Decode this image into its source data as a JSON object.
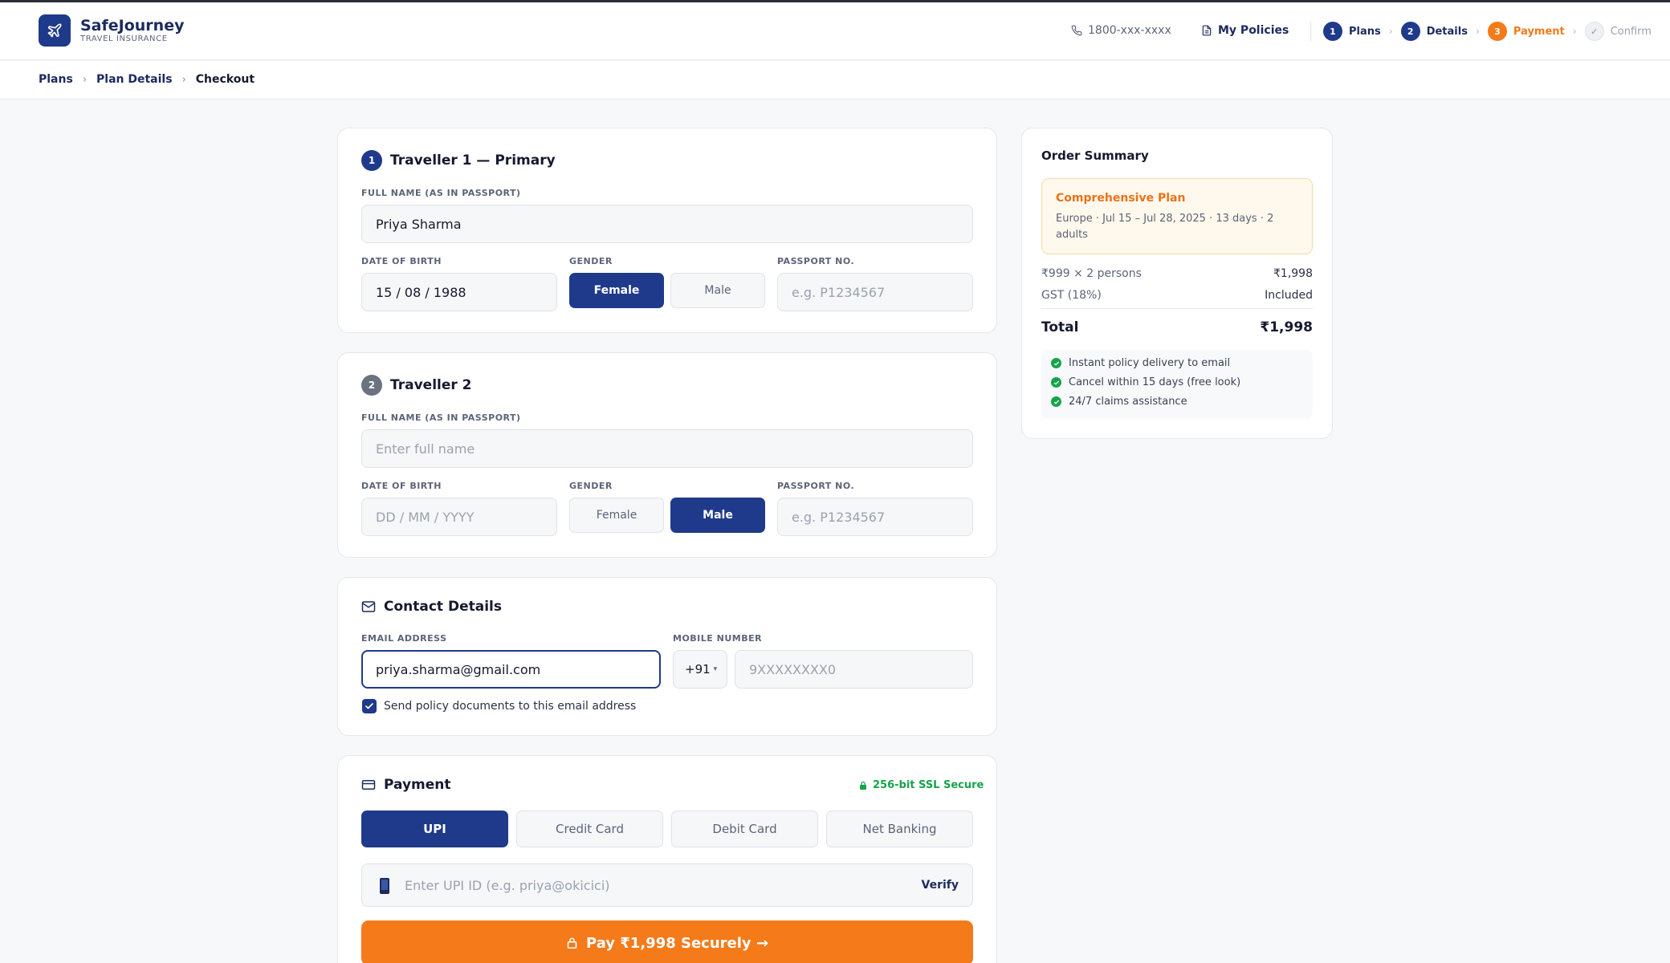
{
  "header": {
    "brand": "SafeJourney",
    "brand_sub": "TRAVEL INSURANCE",
    "phone": "1800-xxx-xxxx",
    "my_policies": "My Policies",
    "steps": [
      {
        "num": "1",
        "label": "Plans",
        "state": "done"
      },
      {
        "num": "2",
        "label": "Details",
        "state": "done"
      },
      {
        "num": "3",
        "label": "Payment",
        "state": "current"
      },
      {
        "num": "✓",
        "label": "Confirm",
        "state": "upcoming"
      }
    ]
  },
  "breadcrumb": {
    "items": [
      "Plans",
      "Plan Details"
    ],
    "current": "Checkout"
  },
  "traveller1": {
    "num": "1",
    "title": "Traveller 1 — Primary",
    "name_label": "FULL NAME (AS IN PASSPORT)",
    "name_value": "Priya Sharma",
    "dob_label": "DATE OF BIRTH",
    "dob_value": "15 / 08 / 1988",
    "gender_label": "GENDER",
    "gender_female": "Female",
    "gender_male": "Male",
    "passport_label": "PASSPORT NO.",
    "passport_placeholder": "e.g. P1234567"
  },
  "traveller2": {
    "num": "2",
    "title": "Traveller 2",
    "name_label": "FULL NAME (AS IN PASSPORT)",
    "name_placeholder": "Enter full name",
    "dob_label": "DATE OF BIRTH",
    "dob_placeholder": "DD / MM / YYYY",
    "gender_label": "GENDER",
    "gender_female": "Female",
    "gender_male": "Male",
    "passport_label": "PASSPORT NO.",
    "passport_placeholder": "e.g. P1234567"
  },
  "contact": {
    "title": "Contact Details",
    "email_label": "EMAIL ADDRESS",
    "email_value": "priya.sharma@gmail.com",
    "mobile_label": "MOBILE NUMBER",
    "country_code": "+91",
    "mobile_placeholder": "9XXXXXXXX0",
    "checkbox_label": "Send policy documents to this email address"
  },
  "payment": {
    "title": "Payment",
    "ssl_badge": "256-bit SSL Secure",
    "methods": [
      "UPI",
      "Credit Card",
      "Debit Card",
      "Net Banking"
    ],
    "upi_placeholder": "Enter UPI ID (e.g. priya@okicici)",
    "verify": "Verify",
    "pay_button": "Pay ₹1,998 Securely →"
  },
  "summary": {
    "title": "Order Summary",
    "plan_name": "Comprehensive Plan",
    "plan_desc": "Europe · Jul 15 – Jul 28, 2025 · 13 days · 2 adults",
    "rows": [
      {
        "label": "₹999 × 2 persons",
        "value": "₹1,998"
      },
      {
        "label": "GST (18%)",
        "value": "Included"
      }
    ],
    "total_label": "Total",
    "total_value": "₹1,998",
    "perks": [
      "Instant policy delivery to email",
      "Cancel within 15 days (free look)",
      "24/7 claims assistance"
    ]
  },
  "colors": {
    "primary": "#1f3a8a",
    "accent": "#f47a1a",
    "success": "#16a34a"
  }
}
